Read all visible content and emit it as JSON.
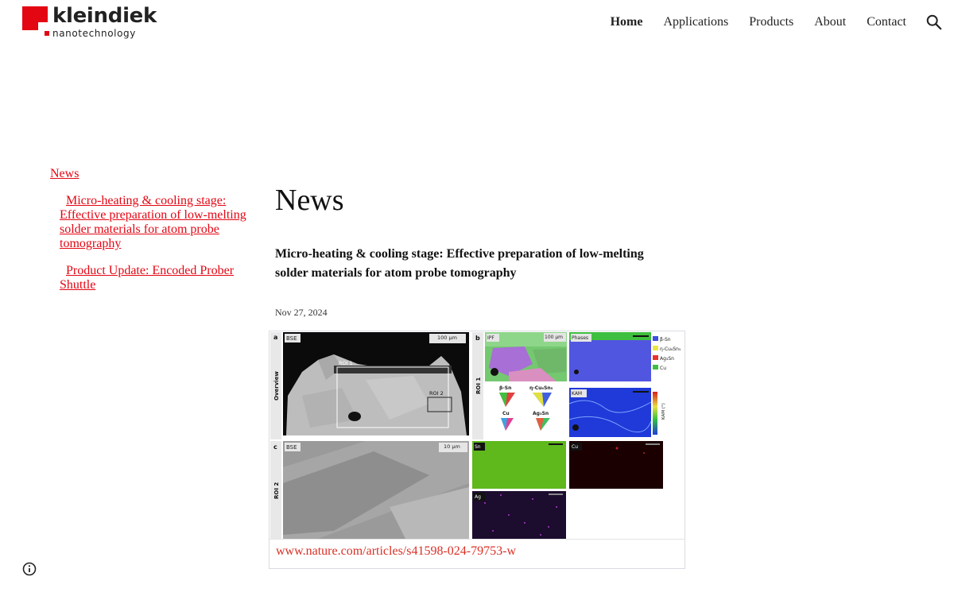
{
  "brand": {
    "name": "kleindiek",
    "subtitle": "nanotechnology",
    "color": "#e30613"
  },
  "nav": {
    "items": [
      "Home",
      "Applications",
      "Products",
      "About",
      "Contact"
    ],
    "active": "Home",
    "search_icon": "search-icon"
  },
  "sidebar": {
    "title": "News",
    "items": [
      "Micro-heating & cooling stage: Effective preparation of low-melting solder materials for atom probe tomography",
      "Product Update: Encoded Prober Shuttle"
    ]
  },
  "main": {
    "page_title": "News",
    "post": {
      "title": "Micro-heating & cooling stage: Effective preparation of low-melting solder materials for atom probe tomography",
      "date": "Nov 27, 2024",
      "link": "www.nature.com/articles/s41598-024-79753-w"
    }
  },
  "figure": {
    "panel_a": {
      "letter": "a",
      "row_label": "Overview",
      "mode": "BSE",
      "scale": "100 µm",
      "roi1": "ROI 1",
      "roi2": "ROI 2"
    },
    "panel_b": {
      "letter": "b",
      "row_label": "ROI 1",
      "ipf": "IPF",
      "ipf_scale": "100 µm",
      "phases": "Phases",
      "kam": "KAM",
      "legend": [
        "β-Sn",
        "η-Cu₆Sn₅",
        "Ag₃Sn",
        "Cu"
      ],
      "legend_colors": [
        "#3b4fe0",
        "#e9e640",
        "#e8332b",
        "#3fbf3f"
      ],
      "triangles": [
        "β-Sn",
        "η-Cu₆Sn₅",
        "Cu",
        "Ag₃Sn"
      ],
      "kam_axis": "KAM (°)"
    },
    "panel_c": {
      "letter": "c",
      "row_label": "ROI 2",
      "mode": "BSE",
      "scale": "10 µm",
      "maps": [
        "Sn",
        "Cu",
        "Ag"
      ]
    }
  },
  "footer": {
    "info_icon": "info-icon"
  }
}
